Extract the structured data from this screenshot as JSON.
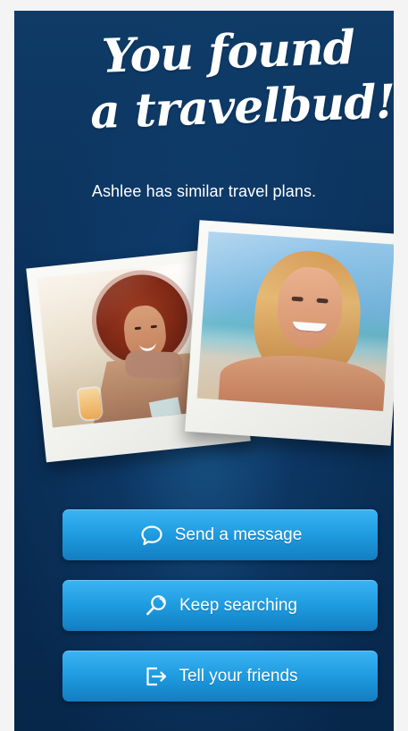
{
  "screen": {
    "title_line_1": "You found",
    "title_line_2": "a travelbud!",
    "subtitle": "Ashlee has similar travel plans."
  },
  "photos": [
    {
      "name": "left-profile-photo"
    },
    {
      "name": "right-profile-photo"
    }
  ],
  "actions": {
    "message": {
      "label": "Send a message",
      "icon": "chat-bubble-icon"
    },
    "search": {
      "label": "Keep searching",
      "icon": "search-icon"
    },
    "friends": {
      "label": "Tell your friends",
      "icon": "share-exit-icon"
    }
  },
  "colors": {
    "background_dark": "#07274a",
    "background_mid": "#0f3b67",
    "button_blue": "#1e9bdf",
    "button_light": "#3ab4f4",
    "text": "#ffffff"
  }
}
